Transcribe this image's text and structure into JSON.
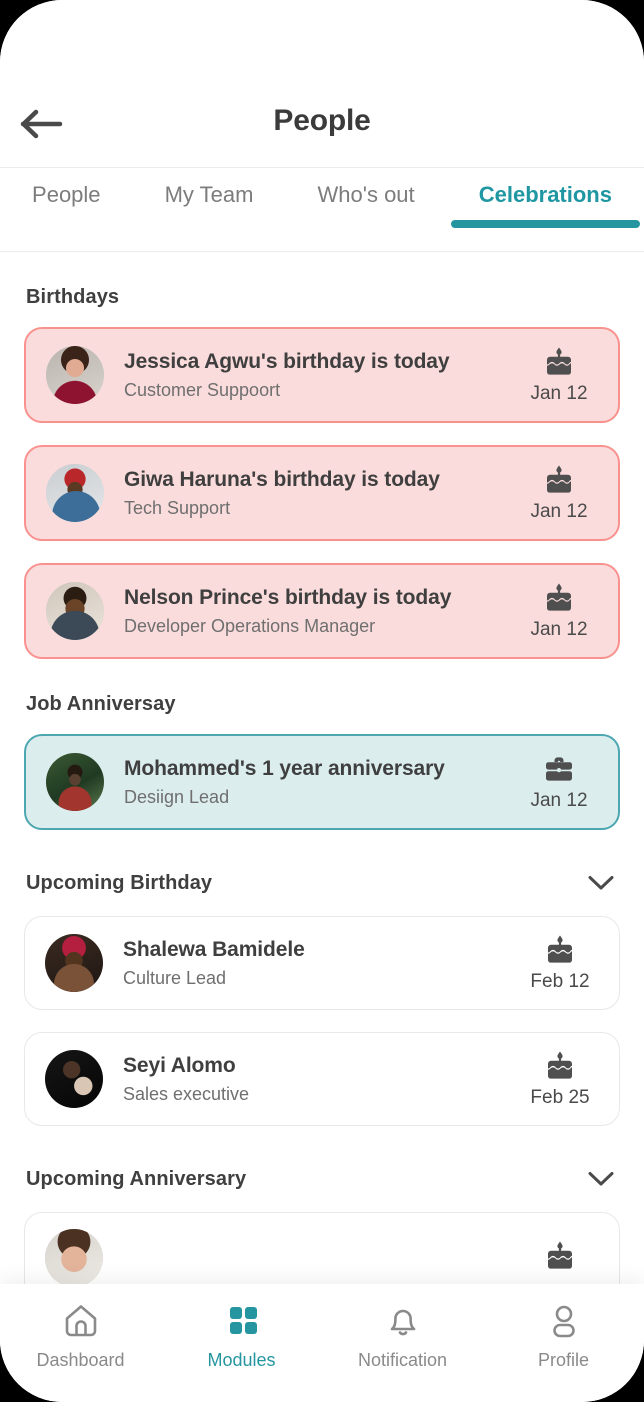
{
  "header": {
    "title": "People",
    "back_icon": "arrow-left-icon"
  },
  "tabs": [
    {
      "label": "People",
      "active": false
    },
    {
      "label": "My Team",
      "active": false
    },
    {
      "label": "Who's out",
      "active": false
    },
    {
      "label": "Celebrations",
      "active": true
    }
  ],
  "sections": {
    "birthdays": {
      "title": "Birthdays",
      "items": [
        {
          "title": "Jessica Agwu's birthday is today",
          "subtitle": "Customer Suppoort",
          "date": "Jan 12",
          "icon": "cake-icon"
        },
        {
          "title": "Giwa Haruna's birthday is today",
          "subtitle": "Tech Support",
          "date": "Jan 12",
          "icon": "cake-icon"
        },
        {
          "title": "Nelson Prince's birthday is today",
          "subtitle": "Developer Operations Manager",
          "date": "Jan 12",
          "icon": "cake-icon"
        }
      ]
    },
    "job_anniversary": {
      "title": "Job Anniversay",
      "items": [
        {
          "title": "Mohammed's 1 year anniversary",
          "subtitle": "Desiign Lead",
          "date": "Jan 12",
          "icon": "briefcase-icon"
        }
      ]
    },
    "upcoming_birthday": {
      "title": "Upcoming Birthday",
      "collapse_icon": "chevron-down-icon",
      "items": [
        {
          "title": "Shalewa Bamidele",
          "subtitle": "Culture Lead",
          "date": "Feb 12",
          "icon": "cake-icon"
        },
        {
          "title": "Seyi Alomo",
          "subtitle": "Sales executive",
          "date": "Feb 25",
          "icon": "cake-icon"
        }
      ]
    },
    "upcoming_anniversary": {
      "title": "Upcoming Anniversary",
      "collapse_icon": "chevron-down-icon",
      "items": [
        {
          "title": "",
          "subtitle": "",
          "date": "",
          "icon": "cake-icon"
        }
      ]
    }
  },
  "bottom_nav": [
    {
      "label": "Dashboard",
      "icon": "home-icon",
      "active": false
    },
    {
      "label": "Modules",
      "icon": "grid-icon",
      "active": true
    },
    {
      "label": "Notification",
      "icon": "bell-icon",
      "active": false
    },
    {
      "label": "Profile",
      "icon": "person-icon",
      "active": false
    }
  ],
  "colors": {
    "accent": "#2596a0",
    "birthday_card_bg": "#fbdcdc",
    "birthday_card_border": "#f9928f",
    "anniversary_card_bg": "#dcedee",
    "anniversary_card_border": "#4da7b0",
    "text_primary": "#3f3f3f",
    "text_secondary": "#6f6f6f"
  }
}
